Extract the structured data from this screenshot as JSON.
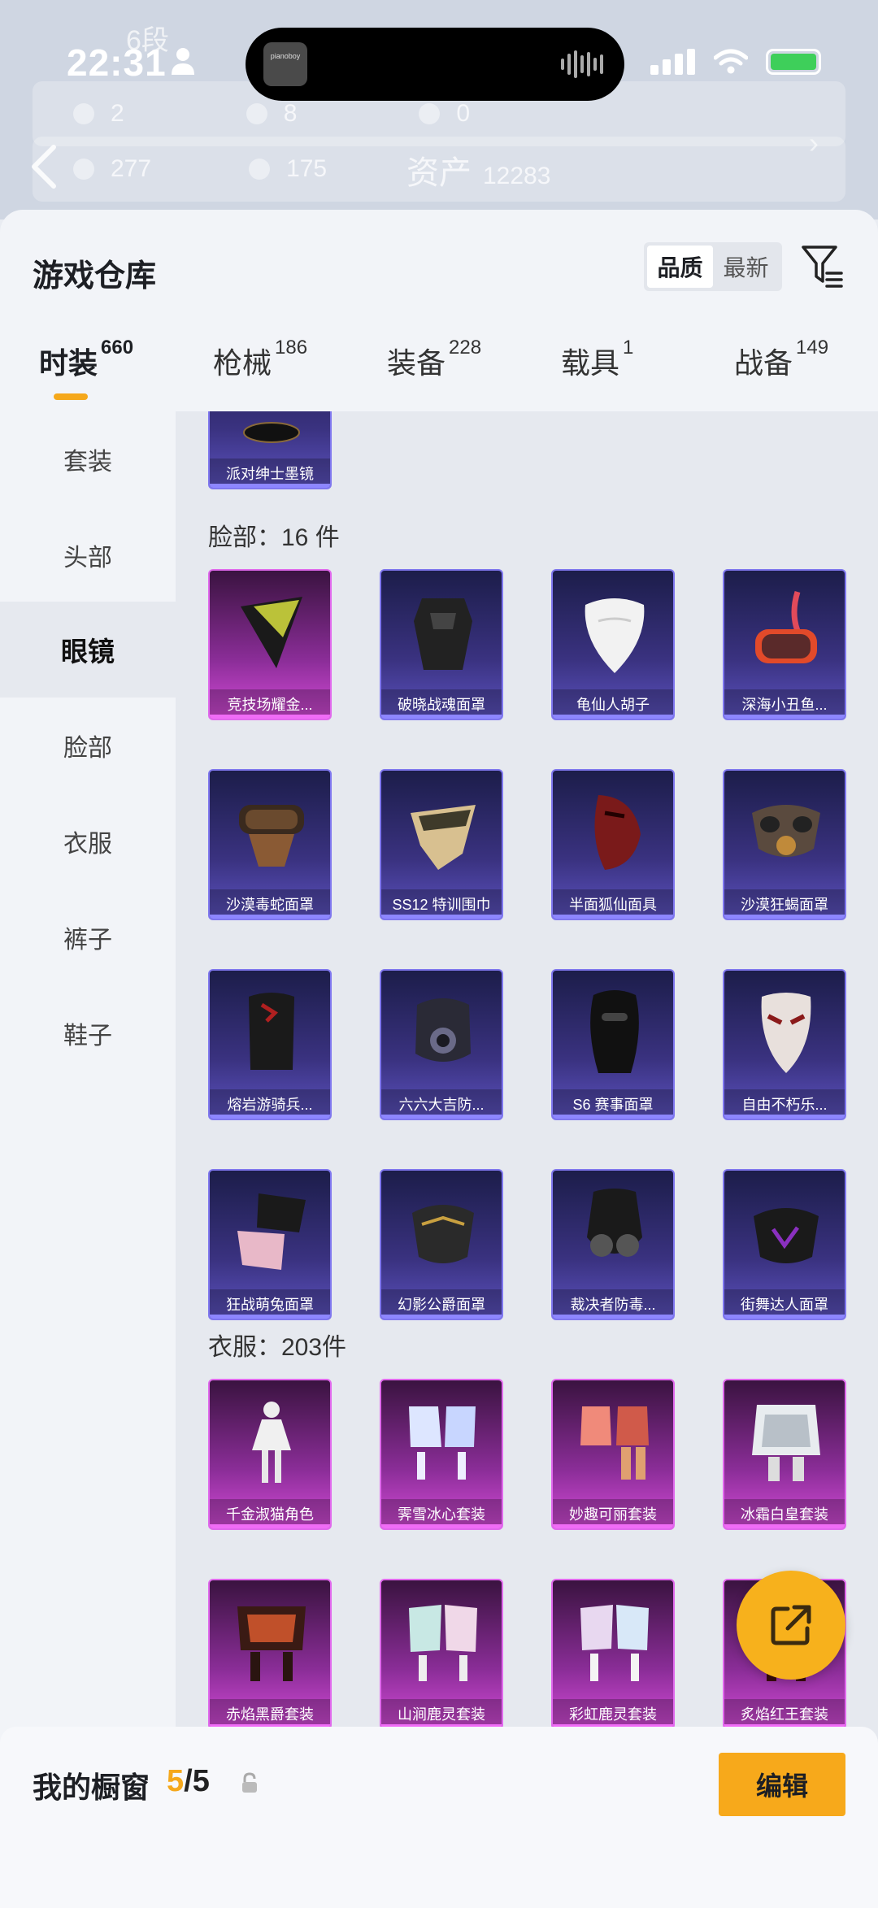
{
  "status_bar": {
    "time": "22:31"
  },
  "now_playing": {
    "art_text": "pianoboy"
  },
  "background_header": {
    "rank": "6段",
    "stats_row1": [
      "2",
      "8",
      "0"
    ],
    "stats_row2": [
      "277",
      "175"
    ],
    "assets_label": "资产",
    "assets_value": "12283"
  },
  "sheet": {
    "title": "游戏仓库",
    "sort": {
      "quality": "品质",
      "latest": "最新"
    }
  },
  "tabs": [
    {
      "label": "时装",
      "count": "660"
    },
    {
      "label": "枪械",
      "count": "186"
    },
    {
      "label": "装备",
      "count": "228"
    },
    {
      "label": "载具",
      "count": "1"
    },
    {
      "label": "战备",
      "count": "149"
    }
  ],
  "side_categories": [
    "套装",
    "头部",
    "眼镜",
    "脸部",
    "衣服",
    "裤子",
    "鞋子"
  ],
  "top_card": {
    "label": "派对绅士墨镜"
  },
  "face_section": {
    "label": "脸部：16 件",
    "items": [
      {
        "label": "竞技场耀金...",
        "rarity": "pink"
      },
      {
        "label": "破晓战魂面罩",
        "rarity": "purple"
      },
      {
        "label": "龟仙人胡子",
        "rarity": "purple"
      },
      {
        "label": "深海小丑鱼...",
        "rarity": "purple"
      },
      {
        "label": "沙漠毒蛇面罩",
        "rarity": "purple"
      },
      {
        "label": "SS12 特训围巾",
        "rarity": "purple"
      },
      {
        "label": "半面狐仙面具",
        "rarity": "purple"
      },
      {
        "label": "沙漠狂蝎面罩",
        "rarity": "purple"
      },
      {
        "label": "熔岩游骑兵...",
        "rarity": "purple"
      },
      {
        "label": "六六大吉防...",
        "rarity": "purple"
      },
      {
        "label": "S6 赛事面罩",
        "rarity": "purple"
      },
      {
        "label": "自由不朽乐...",
        "rarity": "purple"
      },
      {
        "label": "狂战萌兔面罩",
        "rarity": "purple"
      },
      {
        "label": "幻影公爵面罩",
        "rarity": "purple"
      },
      {
        "label": "裁决者防毒...",
        "rarity": "purple"
      },
      {
        "label": "街舞达人面罩",
        "rarity": "purple"
      }
    ]
  },
  "clothes_section": {
    "label": "衣服：203件",
    "items": [
      {
        "label": "千金淑猫角色",
        "rarity": "pink"
      },
      {
        "label": "霁雪冰心套装",
        "rarity": "pink"
      },
      {
        "label": "妙趣可丽套装",
        "rarity": "pink"
      },
      {
        "label": "冰霜白皇套装",
        "rarity": "pink"
      },
      {
        "label": "赤焰黑爵套装",
        "rarity": "pink"
      },
      {
        "label": "山涧鹿灵套装",
        "rarity": "pink"
      },
      {
        "label": "彩虹鹿灵套装",
        "rarity": "pink"
      },
      {
        "label": "炙焰红王套装",
        "rarity": "pink"
      }
    ]
  },
  "showcase": {
    "label": "我的橱窗",
    "current": "5",
    "total": "/5",
    "edit_label": "编辑"
  }
}
